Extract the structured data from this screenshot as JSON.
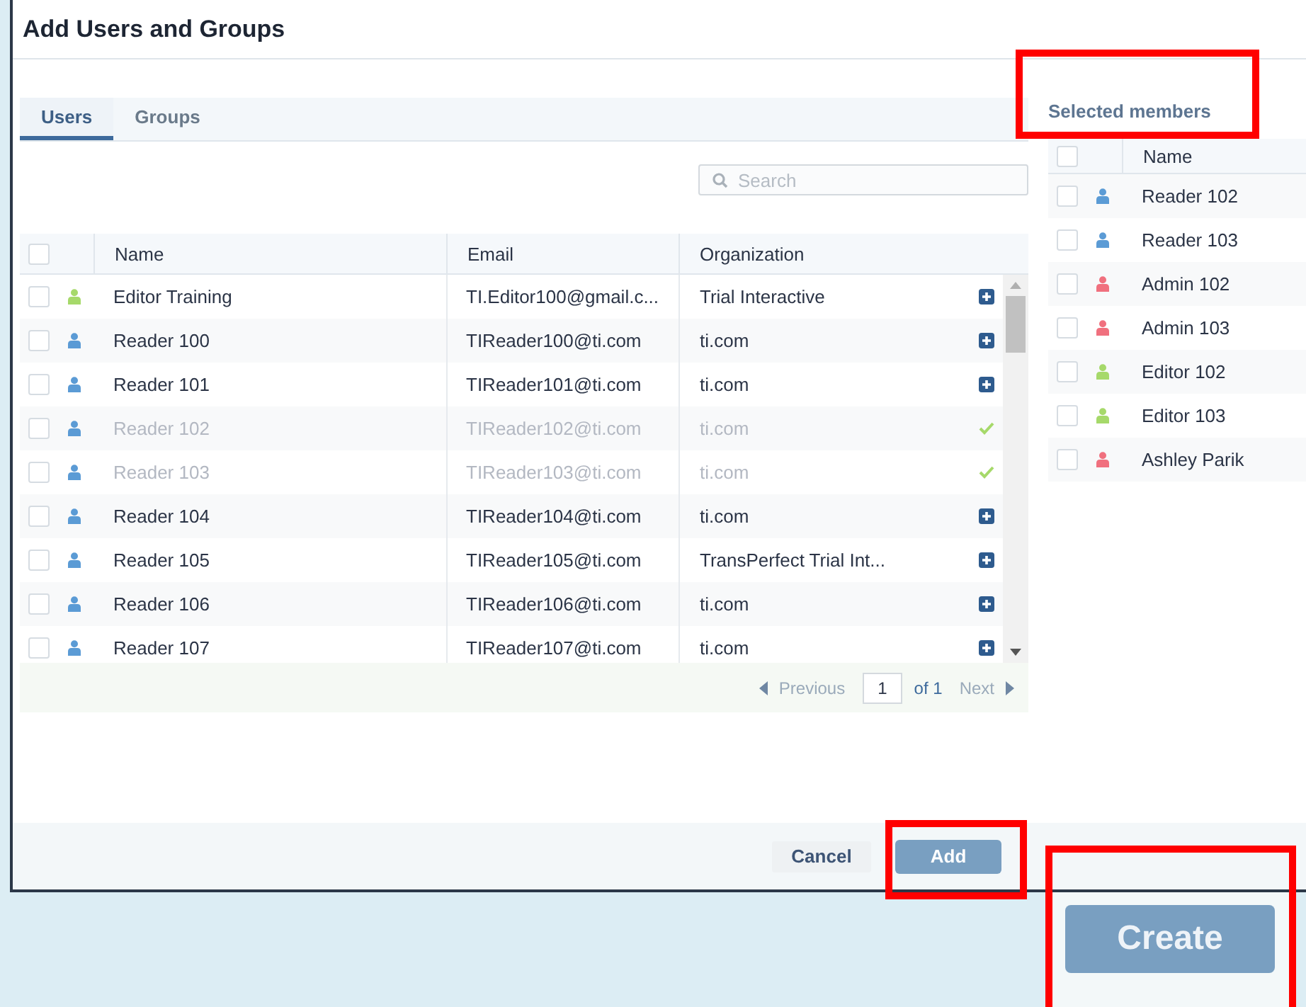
{
  "window": {
    "title": "Add Users and Groups"
  },
  "tabs": [
    {
      "label": "Users",
      "selected": true
    },
    {
      "label": "Groups",
      "selected": false
    }
  ],
  "search": {
    "placeholder": "Search"
  },
  "table": {
    "all_checked": false,
    "columns": [
      "Name",
      "Email",
      "Organization"
    ],
    "rows": [
      {
        "name": "Editor Training",
        "email": "TI.Editor100@gmail.c...",
        "organization": "Trial Interactive",
        "color": "#a6d96a",
        "checked": false,
        "added": false
      },
      {
        "name": "Reader 100",
        "email": "TIReader100@ti.com",
        "organization": "ti.com",
        "color": "#5b9bd5",
        "checked": false,
        "added": false
      },
      {
        "name": "Reader 101",
        "email": "TIReader101@ti.com",
        "organization": "ti.com",
        "color": "#5b9bd5",
        "checked": false,
        "added": false
      },
      {
        "name": "Reader 102",
        "email": "TIReader102@ti.com",
        "organization": "ti.com",
        "color": "#5b9bd5",
        "checked": false,
        "added": true
      },
      {
        "name": "Reader 103",
        "email": "TIReader103@ti.com",
        "organization": "ti.com",
        "color": "#5b9bd5",
        "checked": false,
        "added": true
      },
      {
        "name": "Reader 104",
        "email": "TIReader104@ti.com",
        "organization": "ti.com",
        "color": "#5b9bd5",
        "checked": false,
        "added": false
      },
      {
        "name": "Reader 105",
        "email": "TIReader105@ti.com",
        "organization": "TransPerfect Trial Int...",
        "color": "#5b9bd5",
        "checked": false,
        "added": false
      },
      {
        "name": "Reader 106",
        "email": "TIReader106@ti.com",
        "organization": "ti.com",
        "color": "#5b9bd5",
        "checked": false,
        "added": false
      },
      {
        "name": "Reader 107",
        "email": "TIReader107@ti.com",
        "organization": "ti.com",
        "color": "#5b9bd5",
        "checked": false,
        "added": false
      }
    ]
  },
  "pager": {
    "previous": "Previous",
    "page": "1",
    "of": "of 1",
    "next": "Next"
  },
  "selected_members": {
    "title": "Selected members",
    "all_checked": false,
    "column": "Name",
    "rows": [
      {
        "name": "Reader 102",
        "color": "#5b9bd5",
        "checked": false
      },
      {
        "name": "Reader 103",
        "color": "#5b9bd5",
        "checked": false
      },
      {
        "name": "Admin 102",
        "color": "#f0707e",
        "checked": false
      },
      {
        "name": "Admin 103",
        "color": "#f0707e",
        "checked": false
      },
      {
        "name": "Editor 102",
        "color": "#a6d96a",
        "checked": false
      },
      {
        "name": "Editor 103",
        "color": "#a6d96a",
        "checked": false
      },
      {
        "name": "Ashley Parik",
        "color": "#f0707e",
        "checked": false
      }
    ]
  },
  "buttons": {
    "cancel": "Cancel",
    "add": "Add"
  },
  "create_button": "Create"
}
